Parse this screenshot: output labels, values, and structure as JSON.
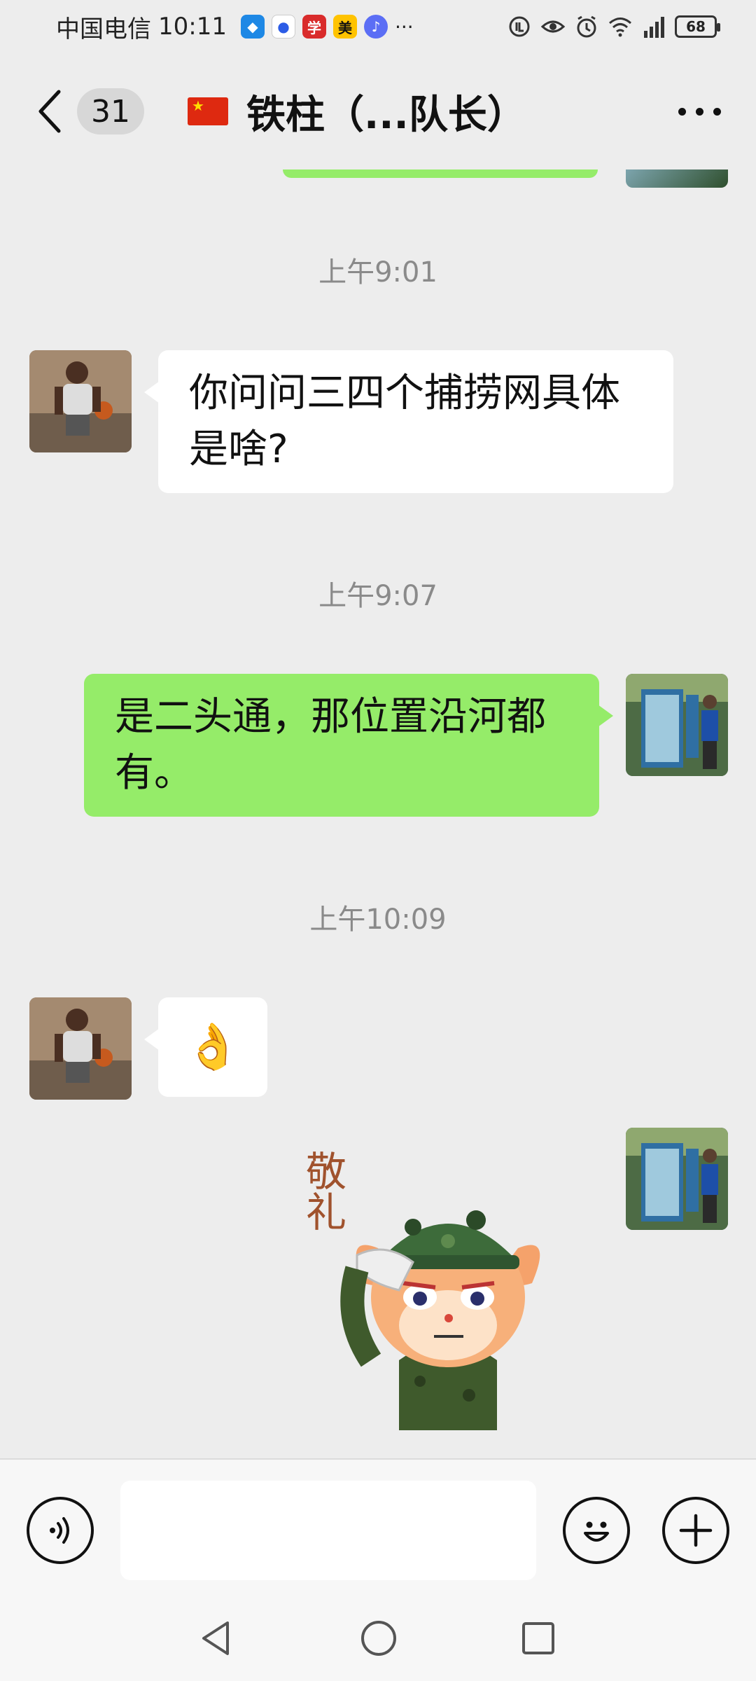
{
  "status_bar": {
    "carrier": "中国电信",
    "time": "10:11",
    "battery": "68",
    "more": "···"
  },
  "header": {
    "unread_count": "31",
    "title": "铁柱（...队长）"
  },
  "messages": [
    {
      "type": "timestamp",
      "text": "上午9:01"
    },
    {
      "type": "incoming",
      "text": "你问问三四个捕捞网具体是啥?"
    },
    {
      "type": "timestamp",
      "text": "上午9:07"
    },
    {
      "type": "outgoing",
      "text": "是二头通，那位置沿河都有。"
    },
    {
      "type": "timestamp",
      "text": "上午10:09"
    },
    {
      "type": "incoming",
      "emoji": "👌"
    },
    {
      "type": "outgoing",
      "sticker": "saluting-deer-sticker",
      "sticker_text": "敬礼"
    }
  ],
  "colors": {
    "background": "#ededed",
    "outgoing_bubble": "#95ec69",
    "incoming_bubble": "#ffffff"
  }
}
